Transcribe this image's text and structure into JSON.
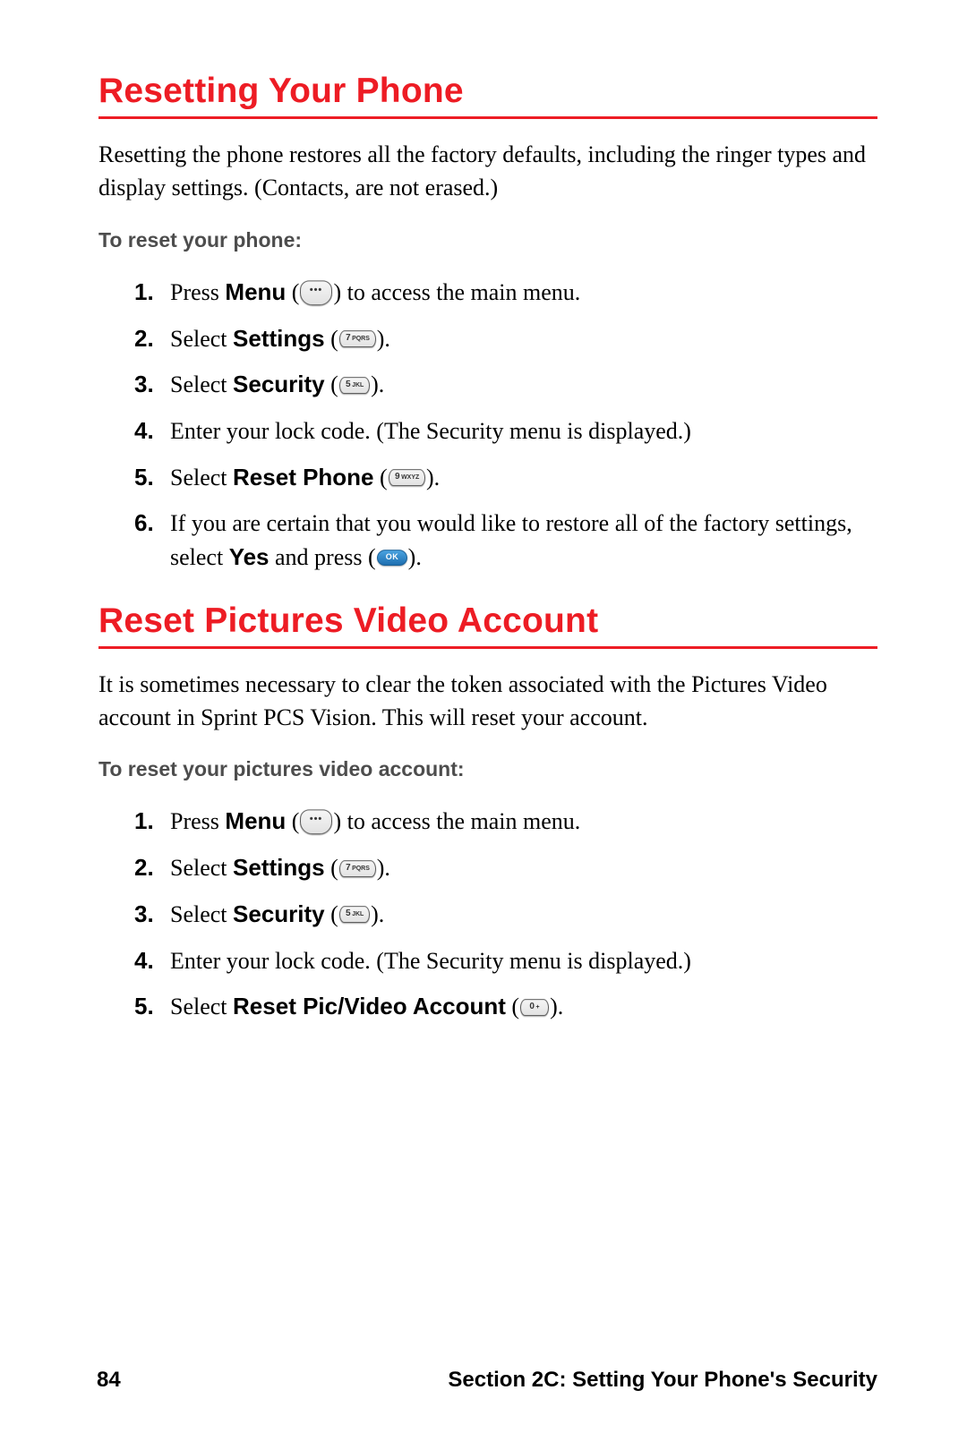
{
  "headings": {
    "reset_phone": "Resetting Your Phone",
    "reset_picvid": "Reset Pictures Video Account"
  },
  "intro": {
    "reset_phone": "Resetting the phone restores all the factory defaults, including the ringer types and display settings. (Contacts, are not erased.)",
    "reset_picvid": "It is sometimes necessary to clear the token associated with the Pictures Video account in Sprint PCS Vision. This will reset your account."
  },
  "subheads": {
    "reset_phone": "To reset your phone:",
    "reset_picvid": "To reset your pictures video account:"
  },
  "steps_reset_phone": {
    "s1_pre": "Press ",
    "s1_bold": "Menu",
    "s1_post": " to access the main menu.",
    "s2_pre": "Select ",
    "s2_bold": "Settings",
    "s3_pre": "Select ",
    "s3_bold": "Security",
    "s4": "Enter your lock code. (The Security menu is displayed.)",
    "s5_pre": "Select ",
    "s5_bold": "Reset Phone",
    "s6_pre": "If you are certain that you would like to restore all of the factory settings, select ",
    "s6_bold": "Yes",
    "s6_mid": " and press ("
  },
  "steps_reset_picvid": {
    "s1_pre": "Press ",
    "s1_bold": "Menu",
    "s1_post": " to access the main menu.",
    "s2_pre": "Select ",
    "s2_bold": "Settings",
    "s3_pre": "Select ",
    "s3_bold": "Security",
    "s4": "Enter your lock code. (The Security menu is displayed.)",
    "s5_pre": "Select ",
    "s5_bold": "Reset Pic/Video Account"
  },
  "keys": {
    "seven": "7",
    "seven_label": "PQRS",
    "five": "5",
    "five_label": "JKL",
    "nine": "9",
    "nine_label": "WXYZ",
    "zero": "0",
    "zero_label": "+",
    "ok": "OK"
  },
  "footer": {
    "page": "84",
    "section": "Section 2C: Setting Your Phone's Security"
  },
  "literals": {
    "open_paren_sp": " (",
    "close_paren_period": ").",
    "close_paren": ")"
  }
}
